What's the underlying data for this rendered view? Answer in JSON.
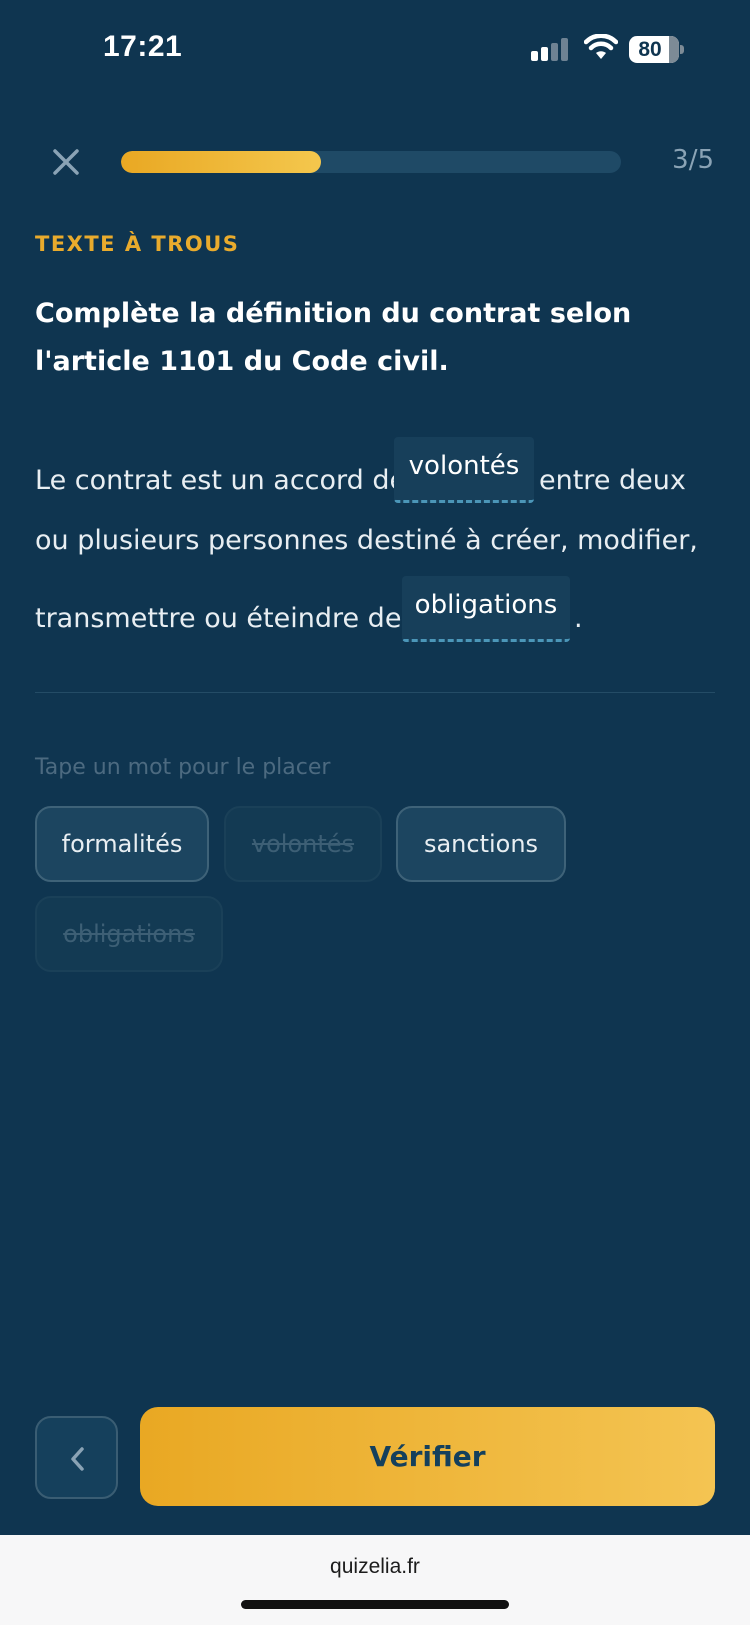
{
  "status_bar": {
    "time": "17:21",
    "battery_level": "80",
    "battery_fraction": 0.8,
    "icons": [
      "signal-icon",
      "wifi-icon",
      "battery-icon"
    ]
  },
  "header": {
    "close_icon": "close-icon",
    "progress_label": "3/5",
    "progress_fraction": 0.4,
    "progress_color": "#e9a823"
  },
  "exercise": {
    "kicker": "TEXTE À TROUS",
    "question": "Complète la définition du contrat selon l'article 1101 du Code civil.",
    "sentence": {
      "part1": "Le contrat est un accord de",
      "blank1": "volontés",
      "part2": "entre deux",
      "part3": "ou plusieurs personnes destiné à créer, modifier,",
      "part4": "transmettre ou éteindre des",
      "blank2": "obligations",
      "part5": "."
    }
  },
  "word_bank": {
    "hint": "Tape un mot pour le placer",
    "chips": [
      {
        "label": "formalités",
        "used": false
      },
      {
        "label": "volontés",
        "used": true
      },
      {
        "label": "sanctions",
        "used": false
      },
      {
        "label": "obligations",
        "used": true
      }
    ]
  },
  "footer": {
    "back_icon": "chevron-left-icon",
    "verify_label": "Vérifier",
    "accent": "#e9a823"
  },
  "browser": {
    "url": "quizelia.fr"
  }
}
